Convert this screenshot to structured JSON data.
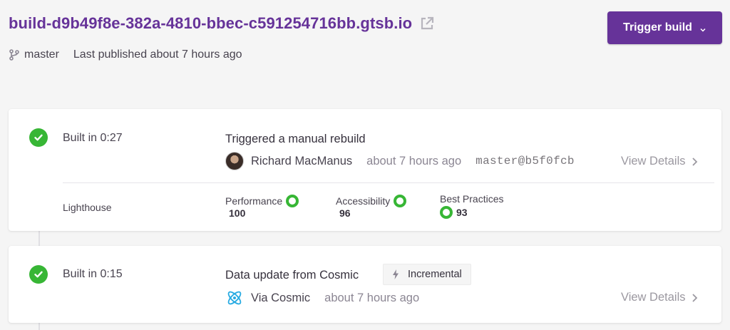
{
  "header": {
    "site_url": "build-d9b49f8e-382a-4810-bbec-c591254716bb.gtsb.io",
    "branch": "master",
    "last_published": "Last published about 7 hours ago",
    "trigger_label": "Trigger build"
  },
  "builds": [
    {
      "status": "success",
      "built_in": "Built in 0:27",
      "title": "Triggered a manual rebuild",
      "author": "Richard MacManus",
      "time": "about 7 hours ago",
      "commit": "master@b5f0fcb",
      "view_details": "View Details",
      "lighthouse": {
        "label": "Lighthouse",
        "metrics": [
          {
            "name": "Performance",
            "score": "100"
          },
          {
            "name": "Accessibility",
            "score": "96"
          },
          {
            "name": "Best Practices",
            "score": "93"
          }
        ]
      }
    },
    {
      "status": "success",
      "built_in": "Built in 0:15",
      "title": "Data update from Cosmic",
      "badge": "Incremental",
      "author": "Via Cosmic",
      "time": "about 7 hours ago",
      "view_details": "View Details"
    }
  ],
  "colors": {
    "brand": "#663399",
    "success": "#37b635",
    "muted": "#8b8693"
  }
}
